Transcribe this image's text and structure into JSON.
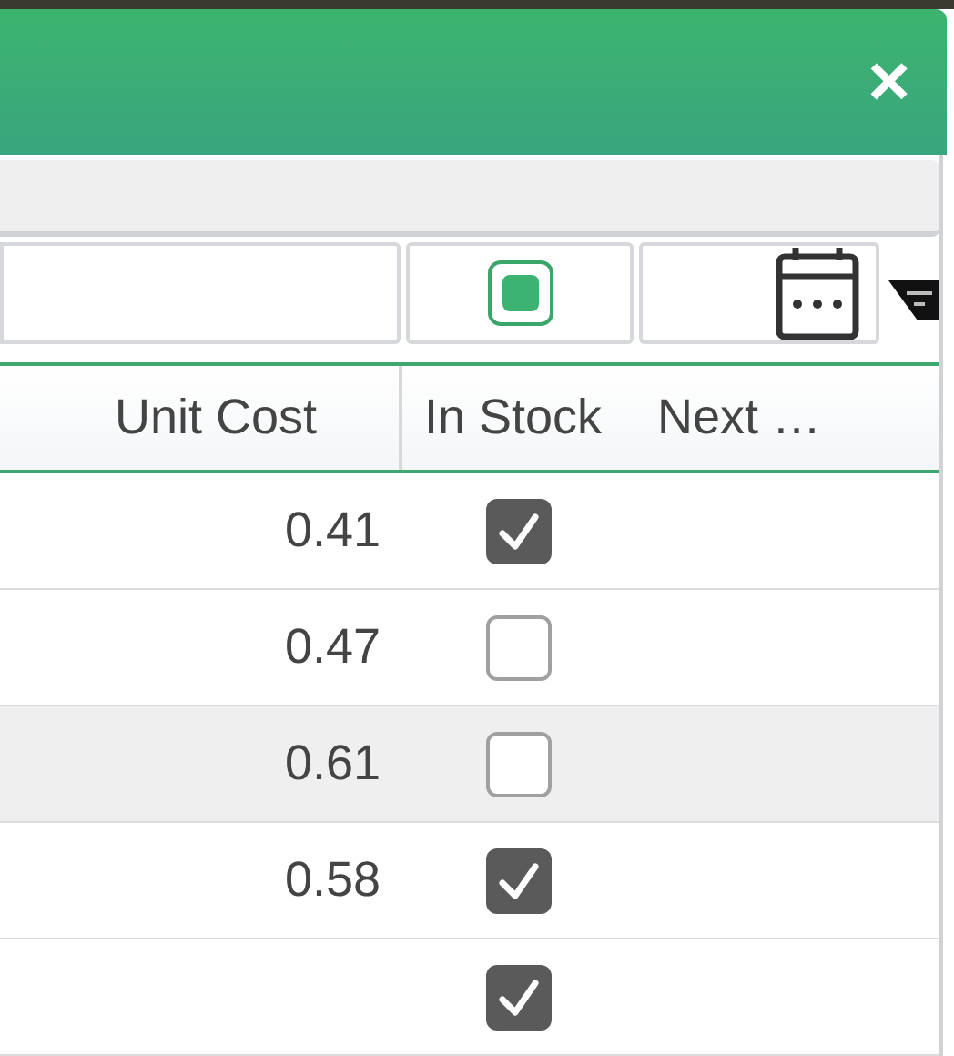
{
  "dialog": {
    "close_label": "×"
  },
  "filter_row": {
    "in_stock_filter": {
      "indeterminate": true
    }
  },
  "table": {
    "columns": [
      {
        "label": "Unit Cost"
      },
      {
        "label": "In Stock"
      },
      {
        "label": "Next …"
      }
    ],
    "rows": [
      {
        "unit_cost": "0.41",
        "in_stock": true,
        "selected": false
      },
      {
        "unit_cost": "0.47",
        "in_stock": false,
        "selected": false
      },
      {
        "unit_cost": "0.61",
        "in_stock": false,
        "selected": true
      },
      {
        "unit_cost": "0.58",
        "in_stock": true,
        "selected": false
      },
      {
        "in_stock": true,
        "selected": false
      }
    ]
  }
}
